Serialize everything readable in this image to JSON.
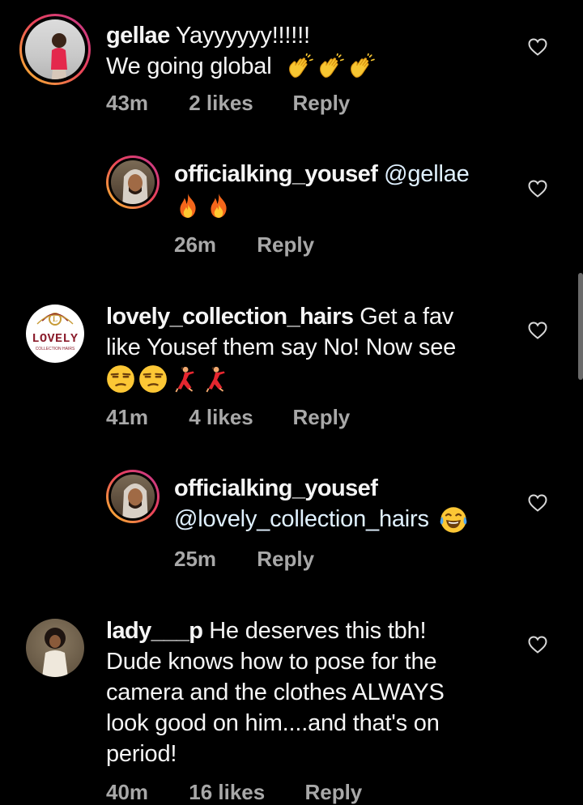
{
  "comments": [
    {
      "username": "gellae",
      "text": "Yayyyyyy!!!!!!",
      "text2": "We going global",
      "emojis": [
        "waving-hand",
        "waving-hand",
        "waving-hand"
      ],
      "time": "43m",
      "likes": "2 likes",
      "reply": "Reply"
    },
    {
      "username": "officialking_yousef",
      "mention": "@gellae",
      "emojis": [
        "fire",
        "fire"
      ],
      "time": "26m",
      "reply": "Reply"
    },
    {
      "username": "lovely_collection_hairs",
      "text": "Get a fav",
      "text2": "like Yousef them say No! Now see",
      "emojis": [
        "unamused-face",
        "unamused-face",
        "dancer",
        "dancer"
      ],
      "time": "41m",
      "likes": "4 likes",
      "reply": "Reply",
      "avatar_logo_text": "LOVELY",
      "avatar_logo_sub": "COLLECTION HAIRS"
    },
    {
      "username": "officialking_yousef",
      "mention": "@lovely_collection_hairs",
      "emojis": [
        "tears-of-joy"
      ],
      "time": "25m",
      "reply": "Reply"
    },
    {
      "username": "lady___p",
      "text": "He deserves this tbh!",
      "lines": [
        "Dude knows how to pose for the",
        "camera and the clothes ALWAYS",
        "look good on him....and that's on",
        "period!"
      ],
      "time": "40m",
      "likes": "16 likes",
      "reply": "Reply"
    }
  ],
  "colors": {
    "background": "#000000",
    "text": "#f5f5f5",
    "meta": "#a8a8a8",
    "mention": "#e0f1ff",
    "story_ring_start": "#f9c02e",
    "story_ring_end": "#c2378f"
  }
}
